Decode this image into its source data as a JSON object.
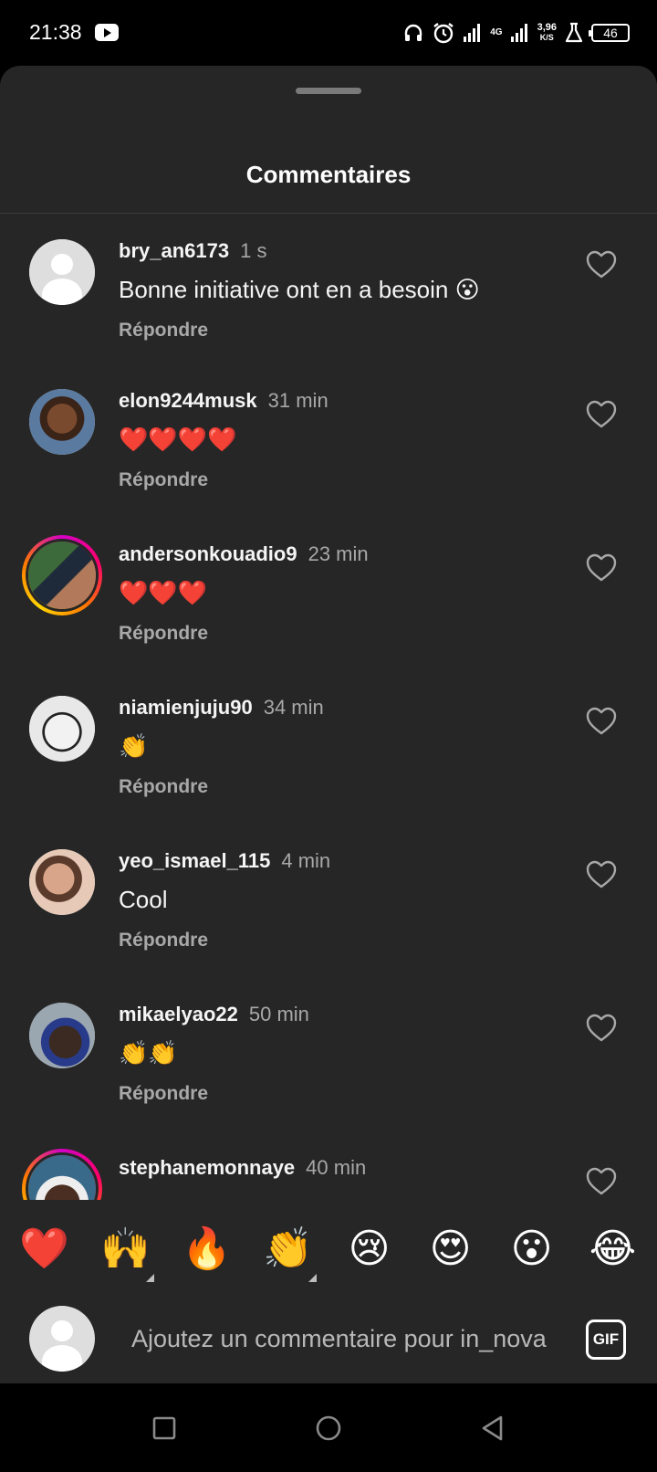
{
  "status_bar": {
    "time": "21:38",
    "network": "4G",
    "speed_value": "3,96",
    "speed_unit": "K/S",
    "battery": "46",
    "icons": [
      "youtube-icon",
      "headphones-icon",
      "alarm-icon",
      "signal-icon",
      "signal-4g-icon",
      "lab-icon",
      "battery-icon"
    ]
  },
  "sheet": {
    "title": "Commentaires"
  },
  "comments": [
    {
      "username": "bry_an6173",
      "time": "1 s",
      "text": "Bonne initiative ont en a besoin 😮",
      "reply": "Répondre",
      "avatar": "default",
      "has_story_ring": false
    },
    {
      "username": "elon9244musk",
      "time": "31 min",
      "text": "❤️❤️❤️❤️",
      "reply": "Répondre",
      "avatar": "photo",
      "has_story_ring": false
    },
    {
      "username": "andersonkouadio9",
      "time": "23 min",
      "text": "❤️❤️❤️",
      "reply": "Répondre",
      "avatar": "photo",
      "has_story_ring": true
    },
    {
      "username": "niamienjuju90",
      "time": "34 min",
      "text": "👏",
      "reply": "Répondre",
      "avatar": "photo",
      "has_story_ring": false
    },
    {
      "username": "yeo_ismael_115",
      "time": "4 min",
      "text": "Cool",
      "reply": "Répondre",
      "avatar": "photo",
      "has_story_ring": false
    },
    {
      "username": "mikaelyao22",
      "time": "50 min",
      "text": "👏👏",
      "reply": "Répondre",
      "avatar": "photo",
      "has_story_ring": false
    },
    {
      "username": "stephanemonnaye",
      "time": "40 min",
      "text": "",
      "reply": "",
      "avatar": "photo",
      "has_story_ring": true
    }
  ],
  "emoji_bar": [
    "❤️",
    "🙌",
    "🔥",
    "👏",
    "😢",
    "😍",
    "😮",
    "😂"
  ],
  "input": {
    "placeholder": "Ajoutez un commentaire pour in_nova",
    "gif_label": "GIF"
  },
  "colors": {
    "sheet_bg": "#262626",
    "secondary_text": "#a8a8a8",
    "story_ring": "#d300c5"
  }
}
